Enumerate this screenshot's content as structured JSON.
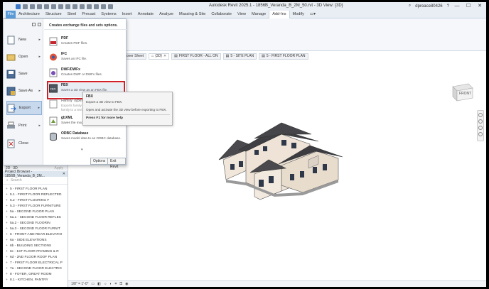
{
  "window": {
    "title": "Autodesk Revit 2025.1 - 1856B_Veranda_B_2M_50.rvt - 3D View: {3D}",
    "user": "dpreace80426",
    "minimize": "—",
    "maximize": "☐",
    "close": "✕"
  },
  "ribbon_tabs": [
    "File",
    "Architecture",
    "Structure",
    "Steel",
    "Precast",
    "Systems",
    "Insert",
    "Annotate",
    "Analyze",
    "Massing & Site",
    "Collaborate",
    "View",
    "Manage",
    "Add-Ins",
    "Modify"
  ],
  "app_menu": {
    "commands": [
      "New",
      "Open",
      "Save",
      "Save As",
      "Export",
      "Print",
      "Close"
    ],
    "header": "Creates exchange files and sets options.",
    "options": [
      {
        "title": "PDF",
        "desc": "Creates PDF files."
      },
      {
        "title": "IFC",
        "desc": "Saves an IFC file."
      },
      {
        "title": "DWF/DWFx",
        "desc": "Creates DWF or DWFx files."
      },
      {
        "title": "FBX",
        "desc": "Saves a 3D view as an FBX file."
      },
      {
        "title": "Family Types",
        "desc": "Exports family types from the current family to a text file."
      },
      {
        "title": "gbXML",
        "desc": "Saves the model as a gbXML file."
      },
      {
        "title": "ODBC Database",
        "desc": "Saves model data to an ODBC database."
      }
    ],
    "options_button": "Options",
    "exit_button": "Exit Revit"
  },
  "tooltip": {
    "title": "FBX",
    "line1": "Export a 3D view to FBX.",
    "line2": "Open and activate the 3D view before exporting to FBX.",
    "footer": "Press F1 for more help"
  },
  "view_tabs": [
    {
      "label": "over Sheet"
    },
    {
      "label": "{3D}"
    },
    {
      "label": "FIRST FLOOR - ALL ON"
    },
    {
      "label": "5 - SITE PLAN"
    },
    {
      "label": "5 - FIRST FLOOR PLAN"
    }
  ],
  "viewcube_label": "FRONT",
  "project_browser": {
    "toggle_a": "2D",
    "toggle_b": "3D",
    "apply": "Apply",
    "title": "Project Browser - 1856B_Veranda_B_2M...",
    "search_placeholder": "Search",
    "items": [
      "5 - FIRST FLOOR PLAN",
      "5.1 - FIRST FLOOR REFLECTED",
      "5.2 - FIRST FLOORING F",
      "5.3 - FIRST FLOOR FURNITURE",
      "5a - SECOND FLOOR PLAN",
      "5a.1 - SECOND FLOOR REFLEC",
      "5a.2 - SECOND FLOORIN",
      "5a.3 - SECOND FLOOR FURNIT",
      "6 - FRONT AND REAR ELEVATIO",
      "6a - SIDE ELEVATIONS",
      "6b - BUILDING SECTIONS",
      "6c - 1ST FLOOR FRAMING & R",
      "6d - 2ND FLOOR ROOF PLAN",
      "7 - FIRST FLOOR ELECTRICAL P",
      "7a - SECOND FLOOR ELECTRIC",
      "8 - FOYER, GREAT ROOM",
      "8.1 - KITCHEN, PANTRY"
    ]
  },
  "status_bar": {
    "scale": "1/8\" = 1'-0\""
  }
}
